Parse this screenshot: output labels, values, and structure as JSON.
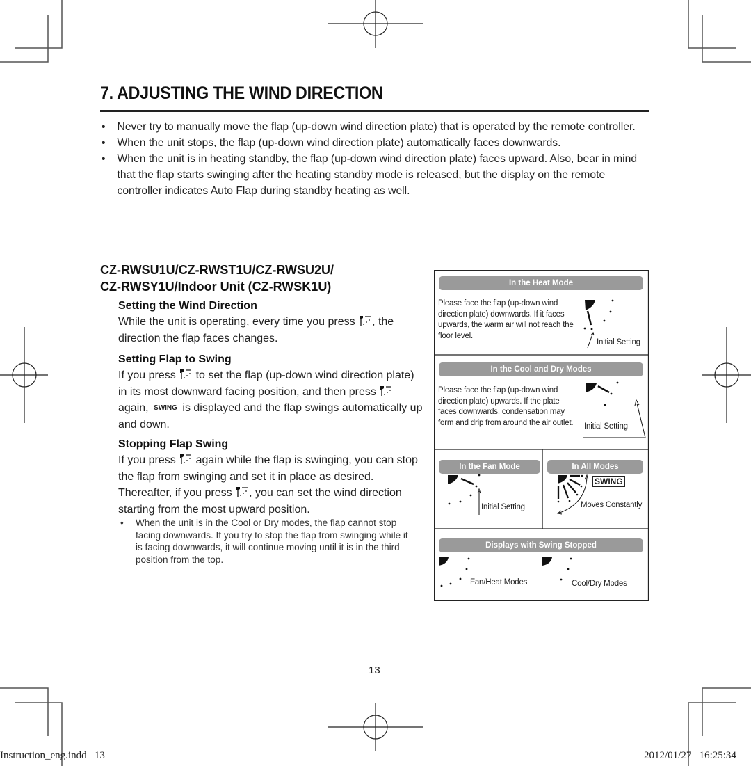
{
  "header": {
    "title": "7. ADJUSTING THE WIND DIRECTION"
  },
  "bullets": [
    "Never try to manually move the flap (up-down wind direction plate) that is operated by the remote controller.",
    "When the unit stops, the flap (up-down wind direction plate) automatically faces downwards.",
    "When the unit is in heating standby, the flap (up-down wind direction plate) faces upward. Also, bear in mind that the flap starts swinging after the heating standby mode is released, but the display on the remote controller indicates Auto Flap during standby heating as well."
  ],
  "models": {
    "line1": "CZ-RWSU1U/CZ-RWST1U/CZ-RWSU2U/",
    "line2": "CZ-RWSY1U/Indoor Unit (CZ-RWSK1U)"
  },
  "sections": {
    "wind_direction": {
      "heading": "Setting the Wind Direction",
      "text_a": "While the unit is operating, every time you press",
      "text_b": ", the direction the flap faces changes."
    },
    "flap_swing": {
      "heading": "Setting Flap to Swing",
      "text_a": "If you press",
      "text_b": " to set the flap (up-down wind direction plate) in its most downward facing position, and then press",
      "text_c": " again, ",
      "badge": "SWING",
      "text_d": " is displayed and the flap swings automatically up and down."
    },
    "stop_swing": {
      "heading": "Stopping Flap Swing",
      "text_a": "If you press",
      "text_b": " again while the flap is swinging, you can stop the flap from swinging and set it in place as desired. Thereafter, if you press",
      "text_c": ", you can set the wind direction starting from the most upward position.",
      "note": "When the unit is in the Cool or Dry modes, the flap cannot stop facing downwards. If you try to stop the flap from swinging while it is facing downwards, it will continue moving until it is in the third position from the top."
    }
  },
  "diagram": {
    "heat": {
      "title": "In the Heat Mode",
      "text": "Please face the flap (up-down wind direction plate) downwards. If it faces upwards, the warm air will not reach the floor level.",
      "label": "Initial Setting"
    },
    "cool_dry": {
      "title": "In the Cool and Dry Modes",
      "text": "Please face the flap (up-down wind direction plate) upwards. If the plate faces downwards, condensation may form and drip from around the air outlet.",
      "label": "Initial Setting"
    },
    "fan": {
      "title": "In the Fan Mode",
      "label": "Initial Setting"
    },
    "all": {
      "title": "In All Modes",
      "badge": "SWING",
      "label": "Moves Constantly"
    },
    "stopped": {
      "title": "Displays with Swing Stopped",
      "left_label": "Fan/Heat Modes",
      "right_label": "Cool/Dry Modes"
    }
  },
  "footer": {
    "page_number": "13",
    "file_slug": "Instruction_eng.indd   13",
    "timestamp": "2012/01/27   16:25:34"
  }
}
